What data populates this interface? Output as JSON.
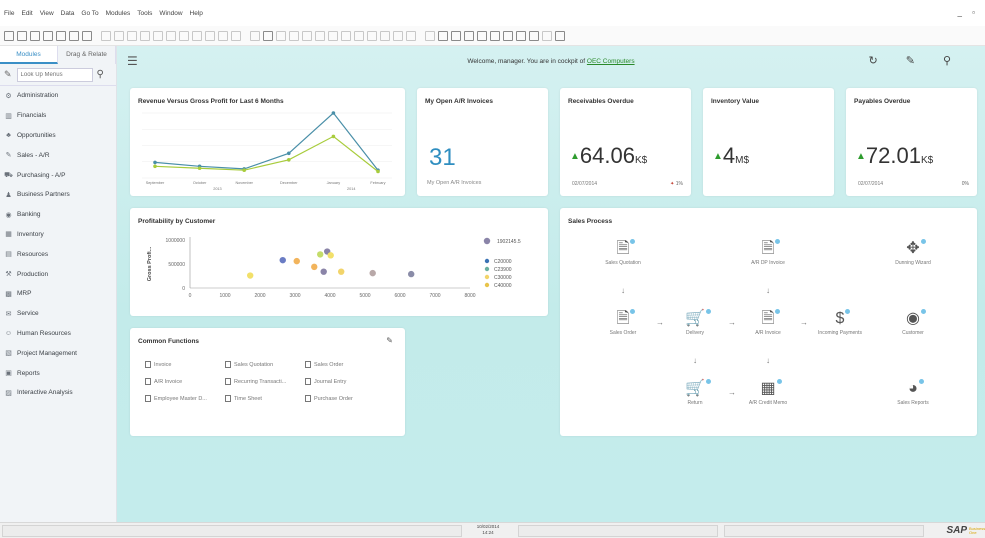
{
  "menu": [
    "File",
    "Edit",
    "View",
    "Data",
    "Go To",
    "Modules",
    "Tools",
    "Window",
    "Help"
  ],
  "window_controls": "_ ▫",
  "sidebar": {
    "tabs": [
      {
        "label": "Modules",
        "active": true
      },
      {
        "label": "Drag & Relate",
        "active": false
      }
    ],
    "search_placeholder": "Look Up Menus",
    "items": [
      {
        "label": "Administration",
        "icon": "admin-icon"
      },
      {
        "label": "Financials",
        "icon": "financials-icon"
      },
      {
        "label": "Opportunities",
        "icon": "opportunities-icon"
      },
      {
        "label": "Sales - A/R",
        "icon": "sales-icon"
      },
      {
        "label": "Purchasing - A/P",
        "icon": "purchasing-icon"
      },
      {
        "label": "Business Partners",
        "icon": "business-partners-icon"
      },
      {
        "label": "Banking",
        "icon": "banking-icon"
      },
      {
        "label": "Inventory",
        "icon": "inventory-icon"
      },
      {
        "label": "Resources",
        "icon": "resources-icon"
      },
      {
        "label": "Production",
        "icon": "production-icon"
      },
      {
        "label": "MRP",
        "icon": "mrp-icon"
      },
      {
        "label": "Service",
        "icon": "service-icon"
      },
      {
        "label": "Human Resources",
        "icon": "human-resources-icon"
      },
      {
        "label": "Project Management",
        "icon": "project-management-icon"
      },
      {
        "label": "Reports",
        "icon": "reports-icon"
      },
      {
        "label": "Interactive Analysis",
        "icon": "interactive-analysis-icon"
      }
    ]
  },
  "header": {
    "welcome_prefix": "Welcome, manager. You are in cockpit of",
    "company": "OEC Computers"
  },
  "revenue_chart": {
    "title": "Revenue Versus Gross Profit for Last 6 Months",
    "chart_data": {
      "type": "line",
      "categories": [
        "September",
        "October",
        "November",
        "December",
        "January",
        "February"
      ],
      "year_labels": [
        "2013",
        "2014"
      ],
      "series": [
        {
          "values": [
            24,
            18,
            14,
            38,
            100,
            12
          ],
          "color": "#4a8fa8"
        },
        {
          "values": [
            18,
            15,
            12,
            28,
            64,
            10
          ],
          "color": "#a8cc3c"
        }
      ]
    }
  },
  "ar_card": {
    "title": "My Open A/R Invoices",
    "value": "31",
    "sub": "My Open A/R Invoices"
  },
  "kpis": [
    {
      "title": "Receivables Overdue",
      "value": "64.06",
      "unit": "K$",
      "date": "02/07/2014",
      "pct": "1%"
    },
    {
      "title": "Inventory Value",
      "value": "4",
      "unit": "M$",
      "date": "",
      "pct": ""
    },
    {
      "title": "Payables Overdue",
      "value": "72.01",
      "unit": "K$",
      "date": "02/07/2014",
      "pct": "0%"
    }
  ],
  "profit_chart": {
    "title": "Profitability by Customer",
    "ylabel": "Gross Profi...",
    "chart_data": {
      "type": "scatter",
      "xlim": [
        0,
        8000
      ],
      "ylim": [
        0,
        1000000
      ],
      "x_ticks": [
        "0",
        "1000",
        "2000",
        "3000",
        "4000",
        "5000",
        "6000",
        "7000",
        "8000"
      ],
      "y_ticks": [
        "0",
        "500000",
        "1000000"
      ],
      "points": [
        {
          "x": 2650,
          "y": 580000,
          "color": "#6a7cc4"
        },
        {
          "x": 3050,
          "y": 560000,
          "color": "#f2b45c"
        },
        {
          "x": 3550,
          "y": 440000,
          "color": "#f2b45c"
        },
        {
          "x": 3720,
          "y": 700000,
          "color": "#c4dc6a"
        },
        {
          "x": 3920,
          "y": 760000,
          "color": "#8a84a8"
        },
        {
          "x": 4020,
          "y": 680000,
          "color": "#f2e06a"
        },
        {
          "x": 1720,
          "y": 260000,
          "color": "#f2e06a"
        },
        {
          "x": 3820,
          "y": 340000,
          "color": "#8a84a8"
        },
        {
          "x": 4320,
          "y": 340000,
          "color": "#f2d46a"
        },
        {
          "x": 5220,
          "y": 310000,
          "color": "#b8a8a8"
        },
        {
          "x": 6320,
          "y": 290000,
          "color": "#8a8ca8"
        }
      ],
      "legend": [
        {
          "label": "1902145.5",
          "color": "#8a84a8"
        },
        {
          "label": "C20000",
          "color": "#3a72b4"
        },
        {
          "label": "C23900",
          "color": "#6ab0a0"
        },
        {
          "label": "C30000",
          "color": "#f2d46a"
        },
        {
          "label": "C40000",
          "color": "#e8c44a"
        }
      ]
    }
  },
  "common_functions": {
    "title": "Common Functions",
    "items": [
      "Invoice",
      "Sales Quotation",
      "Sales Order",
      "A/R Invoice",
      "Recurring Transacti...",
      "Journal Entry",
      "Employee Master D...",
      "Time Sheet",
      "Purchase Order"
    ]
  },
  "sales_process": {
    "title": "Sales Process",
    "nodes": [
      {
        "label": "Sales Quotation",
        "icon": "document-icon"
      },
      {
        "label": "A/R DP Invoice",
        "icon": "dp-invoice-icon"
      },
      {
        "label": "Dunning Wizard",
        "icon": "dunning-icon"
      },
      {
        "label": "Sales Order",
        "icon": "document-icon"
      },
      {
        "label": "Delivery",
        "icon": "cart-icon"
      },
      {
        "label": "A/R Invoice",
        "icon": "invoice-icon"
      },
      {
        "label": "Incoming Payments",
        "icon": "payments-icon"
      },
      {
        "label": "Customer",
        "icon": "customer-icon"
      },
      {
        "label": "Return",
        "icon": "cart-return-icon"
      },
      {
        "label": "A/R Credit Memo",
        "icon": "credit-memo-icon"
      },
      {
        "label": "Sales Reports",
        "icon": "pie-chart-icon"
      }
    ]
  },
  "statusbar": {
    "clock_time": "10/02/2014",
    "clock_date": "14:24",
    "brand": "SAP",
    "brand_sub": "Business One"
  }
}
